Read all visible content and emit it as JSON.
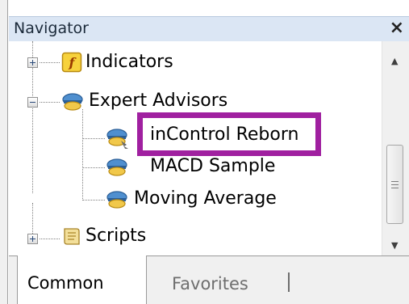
{
  "window": {
    "title": "Navigator",
    "close_glyph": "×"
  },
  "tree": {
    "nodes": [
      {
        "label": "Indicators",
        "icon": "function-icon",
        "expander": "plus"
      },
      {
        "label": "Expert Advisors",
        "icon": "expert-advisor-icon",
        "expander": "minus"
      },
      {
        "label": "inControl Reborn",
        "icon": "expert-advisor-icon",
        "highlighted": true
      },
      {
        "label": "MACD Sample",
        "icon": "expert-advisor-icon"
      },
      {
        "label": "Moving Average",
        "icon": "expert-advisor-icon"
      },
      {
        "label": "Scripts",
        "icon": "script-icon",
        "expander": "plus"
      }
    ]
  },
  "scrollbar": {
    "up_glyph": "▲",
    "down_glyph": "▼"
  },
  "tabs": [
    {
      "label": "Common",
      "active": true
    },
    {
      "label": "Favorites",
      "active": false
    }
  ],
  "colors": {
    "highlight_border": "#a020a0",
    "title_bar": "#dbe6f4"
  }
}
